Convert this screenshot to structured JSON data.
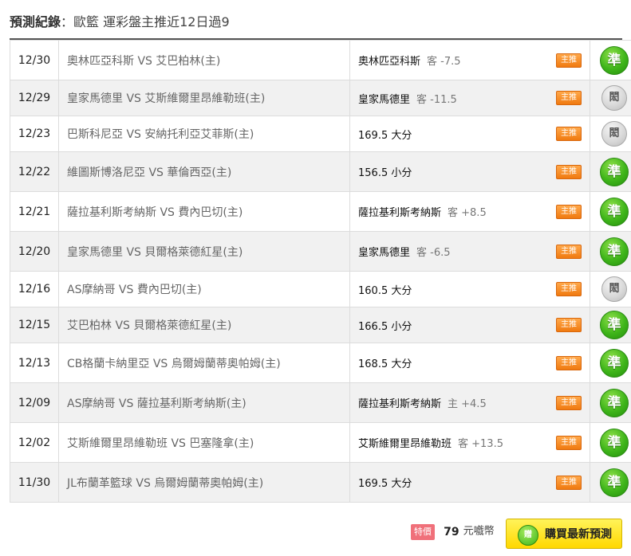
{
  "header": {
    "title": "預測紀錄",
    "separator": "：",
    "subtitle": "歐籃 運彩盤主推近12日過9"
  },
  "tag_label": "主推",
  "rows": [
    {
      "date": "12/30",
      "match": "奧林匹亞科斯 VS 艾巴柏林(主)",
      "pick": "奧林匹亞科斯",
      "odds": "客 -7.5",
      "result": "準",
      "hit": true
    },
    {
      "date": "12/29",
      "match": "皇家馬德里 VS 艾斯維爾里昂維勒班(主)",
      "pick": "皇家馬德里",
      "odds": "客 -11.5",
      "result": "閎",
      "hit": false
    },
    {
      "date": "12/23",
      "match": "巴斯科尼亞 VS 安納托利亞艾菲斯(主)",
      "pick": "169.5 大分",
      "odds": "",
      "result": "閎",
      "hit": false
    },
    {
      "date": "12/22",
      "match": "維圖斯博洛尼亞 VS 華倫西亞(主)",
      "pick": "156.5 小分",
      "odds": "",
      "result": "準",
      "hit": true
    },
    {
      "date": "12/21",
      "match": "薩拉基利斯考納斯 VS 費內巴切(主)",
      "pick": "薩拉基利斯考納斯",
      "odds": "客 +8.5",
      "result": "準",
      "hit": true
    },
    {
      "date": "12/20",
      "match": "皇家馬德里 VS 貝爾格萊德紅星(主)",
      "pick": "皇家馬德里",
      "odds": "客 -6.5",
      "result": "準",
      "hit": true
    },
    {
      "date": "12/16",
      "match": "AS摩納哥 VS 費內巴切(主)",
      "pick": "160.5 大分",
      "odds": "",
      "result": "閎",
      "hit": false
    },
    {
      "date": "12/15",
      "match": "艾巴柏林 VS 貝爾格萊德紅星(主)",
      "pick": "166.5 小分",
      "odds": "",
      "result": "準",
      "hit": true
    },
    {
      "date": "12/13",
      "match": "CB格蘭卡納里亞 VS 烏爾姆蘭蒂奧帕姆(主)",
      "pick": "168.5 大分",
      "odds": "",
      "result": "準",
      "hit": true
    },
    {
      "date": "12/09",
      "match": "AS摩納哥 VS 薩拉基利斯考納斯(主)",
      "pick": "薩拉基利斯考納斯",
      "odds": "主 +4.5",
      "result": "準",
      "hit": true
    },
    {
      "date": "12/02",
      "match": "艾斯維爾里昂維勒班 VS 巴塞隆拿(主)",
      "pick": "艾斯維爾里昂維勒班",
      "odds": "客 +13.5",
      "result": "準",
      "hit": true
    },
    {
      "date": "11/30",
      "match": "JL布蘭革籃球 VS 烏爾姆蘭蒂奧帕姆(主)",
      "pick": "169.5 大分",
      "odds": "",
      "result": "準",
      "hit": true
    }
  ],
  "footer": {
    "sale_tag": "特價",
    "price": "79",
    "currency": "元嚱幣",
    "buy_icon": "贈",
    "buy_label": "購買最新預測"
  },
  "colors": {
    "hit": "#3fb51a",
    "miss": "#cfcfcf",
    "tag": "#f28a1e",
    "buy": "#ffe51a"
  }
}
